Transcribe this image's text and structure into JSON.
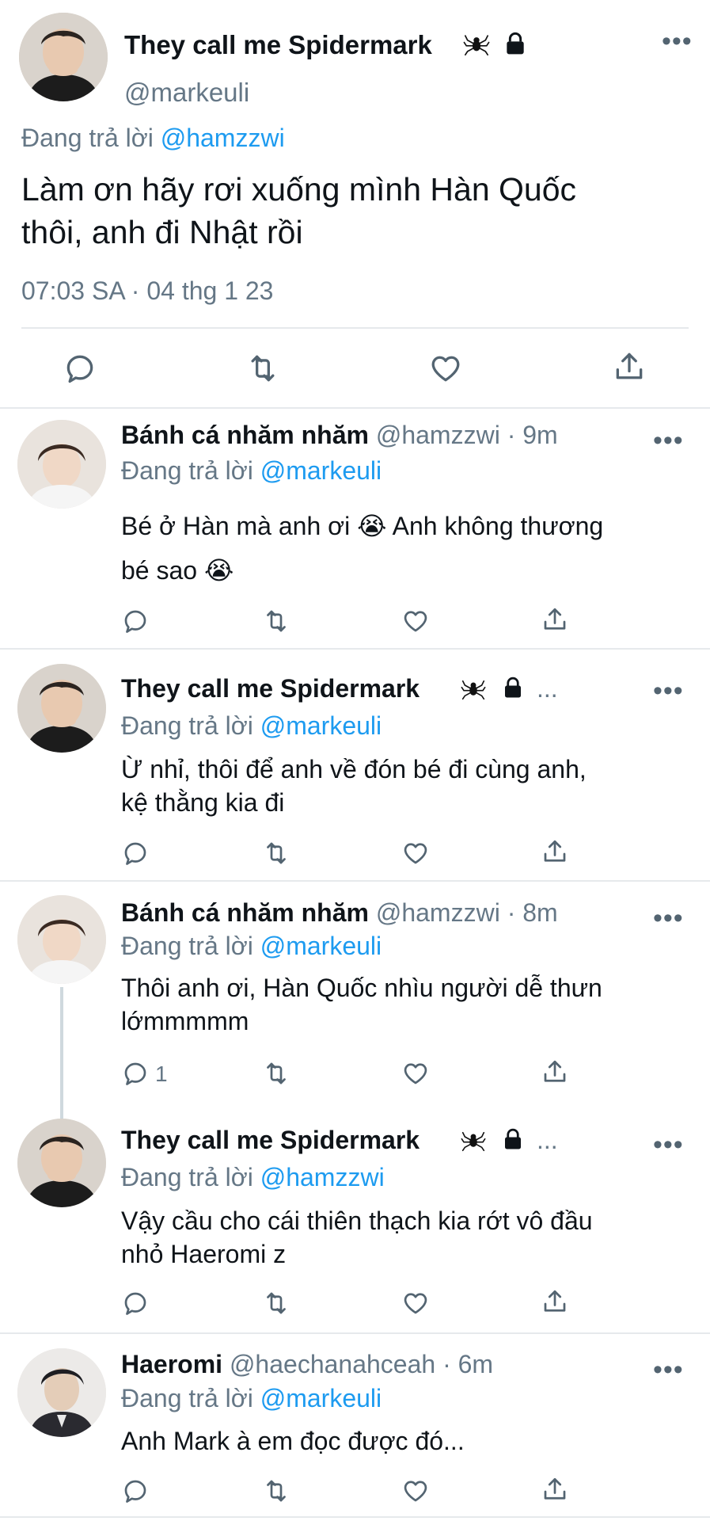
{
  "main": {
    "name": "They call me Spidermark",
    "handle": "@markeuli",
    "reply_prefix": "Đang trả lời",
    "reply_to": "@hamzzwi",
    "text_line1": "Làm ơn hãy rơi xuống mình Hàn Quốc",
    "text_line2": "thôi, anh đi Nhật rồi",
    "timestamp": "07:03 SA · 04 thg 1 23"
  },
  "replies": [
    {
      "name": "Bánh cá nhăm nhăm",
      "handle": "@hamzzwi",
      "time": "· 9m",
      "reply_prefix": "Đang trả lời",
      "reply_to": "@markeuli",
      "line1": "Bé ở Hàn mà anh ơi 😭  Anh không thương",
      "line2": "bé sao 😭",
      "reply_count": ""
    },
    {
      "name": "They call me Spidermark",
      "handle": "...",
      "time": "",
      "reply_prefix": "Đang trả lời",
      "reply_to": "@markeuli",
      "line1": "Ừ nhỉ, thôi để anh về đón bé đi cùng anh,",
      "line2": "kệ thằng kia đi",
      "reply_count": ""
    },
    {
      "name": "Bánh cá nhăm nhăm",
      "handle": "@hamzzwi",
      "time": "· 8m",
      "reply_prefix": "Đang trả lời",
      "reply_to": "@markeuli",
      "line1": "Thôi anh ơi, Hàn Quốc nhìu người dễ thưn",
      "line2": "lớmmmmm",
      "reply_count": "1"
    },
    {
      "name": "They call me Spidermark",
      "handle": "...",
      "time": "",
      "reply_prefix": "Đang trả lời",
      "reply_to": "@hamzzwi",
      "line1": "Vậy cầu cho cái thiên thạch kia rớt vô đầu",
      "line2": "nhỏ Haeromi z",
      "reply_count": ""
    },
    {
      "name": "Haeromi",
      "handle": "@haechanahceah",
      "time": "· 6m",
      "reply_prefix": "Đang trả lời",
      "reply_to": "@markeuli",
      "line1": "Anh Mark à em đọc được đó...",
      "line2": "",
      "reply_count": ""
    }
  ],
  "icons": {
    "reply": "reply-icon",
    "retweet": "retweet-icon",
    "like": "heart-icon",
    "share": "share-icon",
    "spider": "spider-icon",
    "lock": "lock-icon",
    "more": "more-icon"
  },
  "colors": {
    "link": "#1d9bf0",
    "secondary": "#657786",
    "divider": "#e6e9ec"
  }
}
